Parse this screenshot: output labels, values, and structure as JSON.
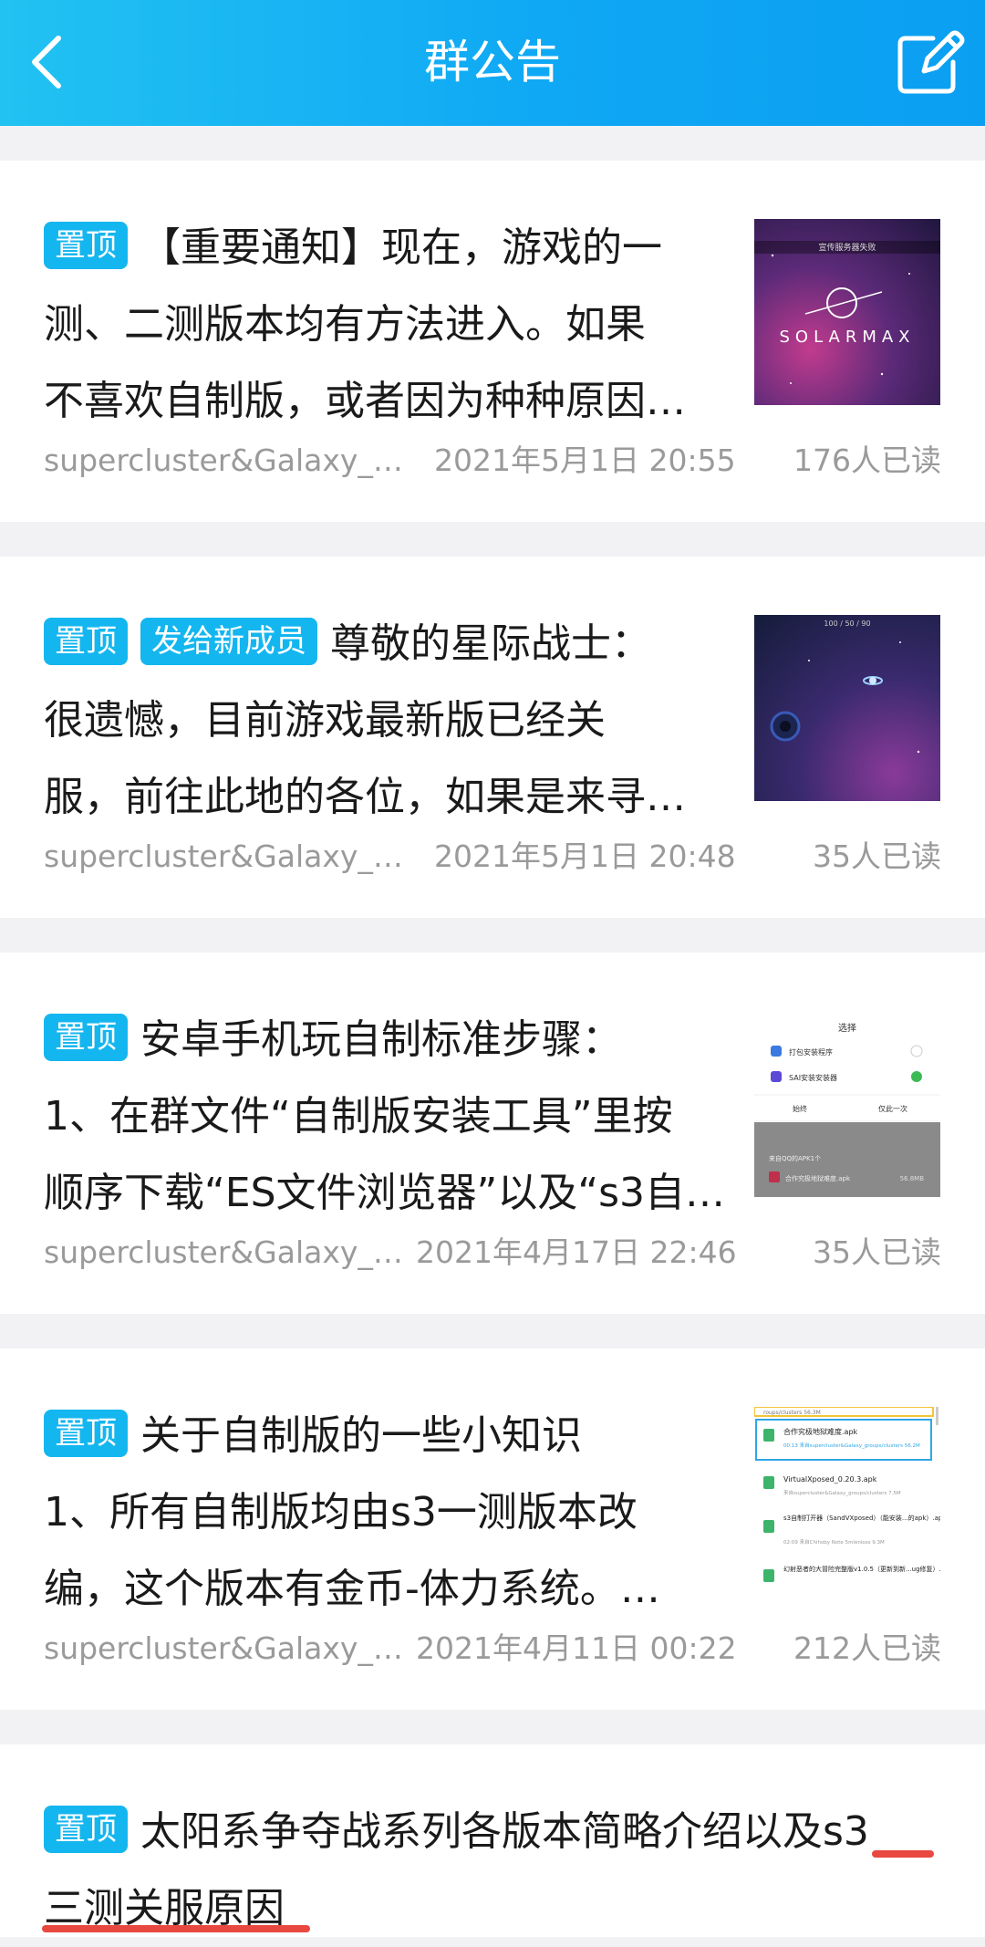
{
  "header": {
    "title": "群公告"
  },
  "announcements": [
    {
      "tags": [
        "置顶"
      ],
      "lines": [
        "【重要通知】现在，游戏的一",
        "测、二测版本均有方法进入。如果",
        "不喜欢自制版，或者因为种种原因…"
      ],
      "author": "supercluster&Galaxy_gr...",
      "date": "2021年5月1日 20:55",
      "reads": "176人已读",
      "thumb": {
        "caption": "宣传服务器失败",
        "logo": "SOLARMAX"
      }
    },
    {
      "tags": [
        "置顶",
        "发给新成员"
      ],
      "lines": [
        "尊敬的星际战士：",
        "很遗憾，目前游戏最新版已经关",
        "服，前往此地的各位，如果是来寻…"
      ],
      "author": "supercluster&Galaxy_gr...",
      "date": "2021年5月1日 20:48",
      "reads": "35人已读",
      "thumb": {
        "caption": "100 / 50 / 90"
      }
    },
    {
      "tags": [
        "置顶"
      ],
      "lines": [
        "安卓手机玩自制标准步骤：",
        "1、在群文件“自制版安装工具”里按",
        "顺序下载“ES文件浏览器”以及“s3自…"
      ],
      "author": "supercluster&Galaxy_g...",
      "date": "2021年4月17日 22:46",
      "reads": "35人已读",
      "thumb": {
        "dialog_title": "选择",
        "option1": "打包安装程序",
        "option2": "SAI安装安装器",
        "btn_once": "始终",
        "btn_always": "仅此一次",
        "footer1": "来自QQ的APK1个",
        "footer2": "合作究极地狱难度.apk",
        "footer2_size": "56.8MB"
      }
    },
    {
      "tags": [
        "置顶"
      ],
      "lines": [
        "关于自制版的一些小知识",
        "1、所有自制版均由s3一测版本改",
        "编，这个版本有金币-体力系统。…"
      ],
      "author": "supercluster&Galaxy_g...",
      "date": "2021年4月11日 00:22",
      "reads": "212人已读",
      "thumb": {
        "top": "roups/clusters 56.3M",
        "f1": "合作究极地狱难度.apk",
        "f1_sub": "00:13 来自supercluster&Galaxy_groups/clusters 56.2M",
        "f2": "VirtualXposed_0.20.3.apk",
        "f2_sub": "来自supercluster&Galaxy_groups/clusters 7.5M",
        "f3": "s3自制打开器（SandVXposed）（能安装...的apk）.apk",
        "f3_sub": "02:09 来自Chihoby Note 5mlenioss 9.3M",
        "f4": "幻射恶者的大冒险完整版v1.0.5（更新到新...ug修复）.apk"
      }
    },
    {
      "tags": [
        "置顶"
      ],
      "lines": [
        "太阳系争夺战系列各版本简略介绍以及s3",
        "三测关服原因"
      ]
    }
  ],
  "colors": {
    "accent": "#14b6ef",
    "header": "#0fa8f4",
    "underline": "#e8483f"
  }
}
